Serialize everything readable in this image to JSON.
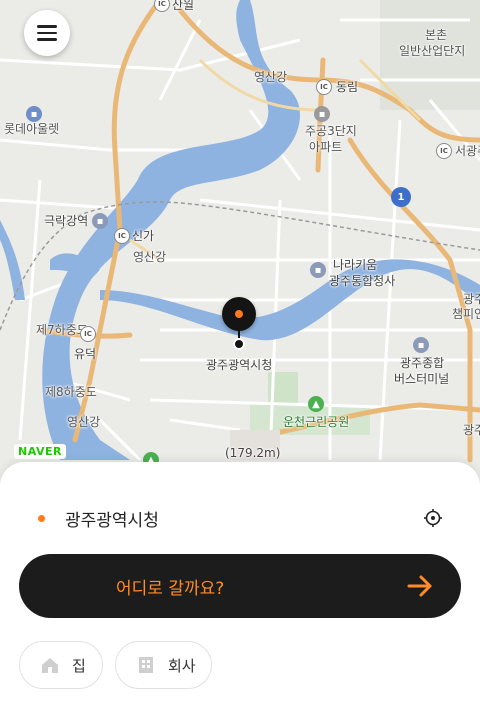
{
  "map": {
    "provider_logo": "NAVER",
    "labels": {
      "sanwol": "산월",
      "bonchon": "본촌",
      "bonchon_industrial": "일반산업단지",
      "yeongsangang_top": "영산강",
      "dongrim": "동림",
      "lotte_mart": "롯데아울렛",
      "jugong3": "주공3단지",
      "apartment": "아파트",
      "seogwang": "서광주",
      "geukrak": "극락강역",
      "singa": "신가",
      "yeongsangang_mid": "영산강",
      "narakium": "나라키움",
      "gwangju_gov": "광주통합청사",
      "gwangju_champion": "광주",
      "champion": "챔피언",
      "je7hajungdo": "제7하중도",
      "yudeok": "유덕",
      "city_hall_map": "광주광역시청",
      "bus_terminal_1": "광주종합",
      "bus_terminal_2": "버스터미널",
      "je8hajungdo": "제8하중도",
      "yeongsangang_bottom": "영산강",
      "uncheon_park": "운천근린공원",
      "gwangju_right": "광주",
      "elevation": "(179.2m)"
    },
    "ic_badge": "IC",
    "route_badge": "1"
  },
  "menu": {
    "icon": "hamburger-menu-icon"
  },
  "origin": {
    "label": "광주광역시청",
    "icon": "current-location-target-icon"
  },
  "destination_button": {
    "label": "어디로 갈까요?",
    "icon": "arrow-right-icon"
  },
  "shortcuts": [
    {
      "label": "집",
      "icon": "home-icon"
    },
    {
      "label": "회사",
      "icon": "building-icon"
    }
  ],
  "colors": {
    "accent": "#ff7a1a",
    "button_bg": "#1c1c1c",
    "river": "#8fb3e0",
    "highway": "#e9b877",
    "naver_green": "#1ec800"
  }
}
